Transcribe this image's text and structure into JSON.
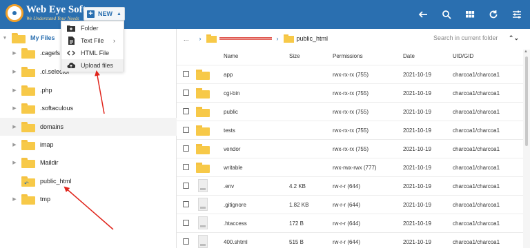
{
  "brand": {
    "name": "Web Eye Soft",
    "tagline": "We Understand Your Needs"
  },
  "toolbar": {
    "new_label": "NEW"
  },
  "top_icons": [
    "back-arrow-icon",
    "search-icon",
    "grid-view-icon",
    "refresh-icon",
    "settings-sliders-icon"
  ],
  "new_menu": [
    {
      "label": "Folder",
      "icon": "new-folder-icon"
    },
    {
      "label": "Text File",
      "icon": "text-file-icon",
      "has_submenu": true
    },
    {
      "label": "HTML File",
      "icon": "code-icon"
    },
    {
      "label": "Upload files",
      "icon": "cloud-upload-icon"
    }
  ],
  "tree": {
    "root_label": "My Files",
    "items": [
      ".cagefs",
      ".cl.selector",
      ".php",
      ".softaculous",
      "domains",
      "imap",
      "Maildir",
      "public_html",
      "tmp"
    ]
  },
  "breadcrumb": {
    "dots": "...",
    "current": "public_html"
  },
  "search": {
    "placeholder": "Search in current folder"
  },
  "table": {
    "columns": [
      "Name",
      "Size",
      "Permissions",
      "Date",
      "UID/GID"
    ],
    "rows": [
      {
        "name": "app",
        "type": "folder",
        "size": "",
        "permissions": "rwx-rx-rx (755)",
        "date": "2021-10-19",
        "uid": "charcoa1/charcoa1"
      },
      {
        "name": "cgi-bin",
        "type": "folder",
        "size": "",
        "permissions": "rwx-rx-rx (755)",
        "date": "2021-10-19",
        "uid": "charcoa1/charcoa1"
      },
      {
        "name": "public",
        "type": "folder",
        "size": "",
        "permissions": "rwx-rx-rx (755)",
        "date": "2021-10-19",
        "uid": "charcoa1/charcoa1"
      },
      {
        "name": "tests",
        "type": "folder",
        "size": "",
        "permissions": "rwx-rx-rx (755)",
        "date": "2021-10-19",
        "uid": "charcoa1/charcoa1"
      },
      {
        "name": "vendor",
        "type": "folder",
        "size": "",
        "permissions": "rwx-rx-rx (755)",
        "date": "2021-10-19",
        "uid": "charcoa1/charcoa1"
      },
      {
        "name": "writable",
        "type": "folder",
        "size": "",
        "permissions": "rwx-rwx-rwx (777)",
        "date": "2021-10-19",
        "uid": "charcoa1/charcoa1"
      },
      {
        "name": ".env",
        "type": "file",
        "size": "4.2 KB",
        "permissions": "rw-r-r (644)",
        "date": "2021-10-19",
        "uid": "charcoa1/charcoa1"
      },
      {
        "name": ".gitignore",
        "type": "file",
        "size": "1.82 KB",
        "permissions": "rw-r-r (644)",
        "date": "2021-10-19",
        "uid": "charcoa1/charcoa1"
      },
      {
        "name": ".htaccess",
        "type": "file",
        "size": "172 B",
        "permissions": "rw-r-r (644)",
        "date": "2021-10-19",
        "uid": "charcoa1/charcoa1"
      },
      {
        "name": "400.shtml",
        "type": "file",
        "size": "515 B",
        "permissions": "rw-r-r (644)",
        "date": "2021-10-19",
        "uid": "charcoa1/charcoa1"
      }
    ]
  },
  "colors": {
    "topbar": "#2a6fb0",
    "folder": "#f7c948",
    "annotation_arrow": "#e0241b"
  }
}
